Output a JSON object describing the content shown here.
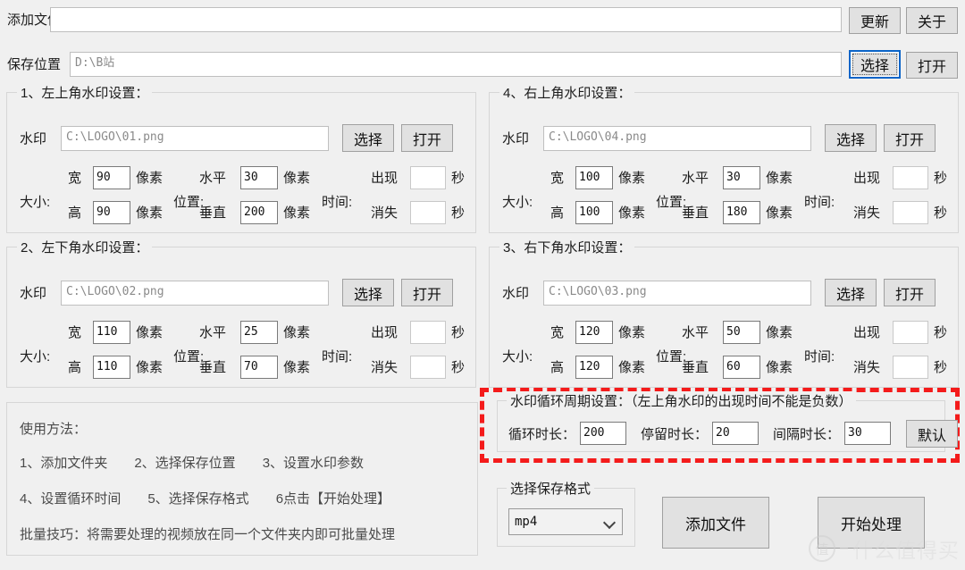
{
  "toolbar": {
    "add_file_label": "添加文件",
    "add_file_value": "",
    "update_button": "更新",
    "about_button": "关于",
    "save_location_label": "保存位置",
    "save_location_value": "D:\\B站",
    "choose_button": "选择",
    "open_button": "打开"
  },
  "common": {
    "watermark_label": "水印",
    "choose_button": "选择",
    "open_button": "打开",
    "size_label": "大小:",
    "position_label": "位置:",
    "time_label": "时间:",
    "width_label": "宽",
    "height_label": "高",
    "horizontal_label": "水平",
    "vertical_label": "垂直",
    "pixel_unit": "像素",
    "appear_label": "出现",
    "disappear_label": "消失",
    "second_unit": "秒"
  },
  "panels": [
    {
      "id": "panel1",
      "title": "1、左上角水印设置：",
      "watermark_path": "C:\\LOGO\\01.png",
      "width": "90",
      "height": "90",
      "horizontal": "30",
      "vertical": "200",
      "appear": "",
      "disappear": ""
    },
    {
      "id": "panel4",
      "title": "4、右上角水印设置：",
      "watermark_path": "C:\\LOGO\\04.png",
      "width": "100",
      "height": "100",
      "horizontal": "30",
      "vertical": "180",
      "appear": "",
      "disappear": ""
    },
    {
      "id": "panel2",
      "title": "2、左下角水印设置：",
      "watermark_path": "C:\\LOGO\\02.png",
      "width": "110",
      "height": "110",
      "horizontal": "25",
      "vertical": "70",
      "appear": "",
      "disappear": ""
    },
    {
      "id": "panel3",
      "title": "3、右下角水印设置：",
      "watermark_path": "C:\\LOGO\\03.png",
      "width": "120",
      "height": "120",
      "horizontal": "50",
      "vertical": "60",
      "appear": "",
      "disappear": ""
    }
  ],
  "help": {
    "heading": "使用方法：",
    "step1": "1、添加文件夹",
    "step2": "2、选择保存位置",
    "step3": "3、设置水印参数",
    "step4": "4、设置循环时间",
    "step5": "5、选择保存格式",
    "step6": "6点击【开始处理】",
    "tip": "批量技巧：将需要处理的视频放在同一个文件夹内即可批量处理"
  },
  "cycle": {
    "title": "水印循环周期设置：（左上角水印的出现时间不能是负数）",
    "loop_label": "循环时长：",
    "loop_value": "200",
    "stay_label": "停留时长：",
    "stay_value": "20",
    "interval_label": "间隔时长：",
    "interval_value": "30",
    "default_button": "默认",
    "highlight_color": "#f41b1b"
  },
  "format": {
    "title": "选择保存格式",
    "selected": "mp4"
  },
  "actions": {
    "add_file_button": "添加文件",
    "start_button": "开始处理"
  },
  "watermark_overlay": {
    "badge": "值",
    "text": "什么值得买"
  }
}
